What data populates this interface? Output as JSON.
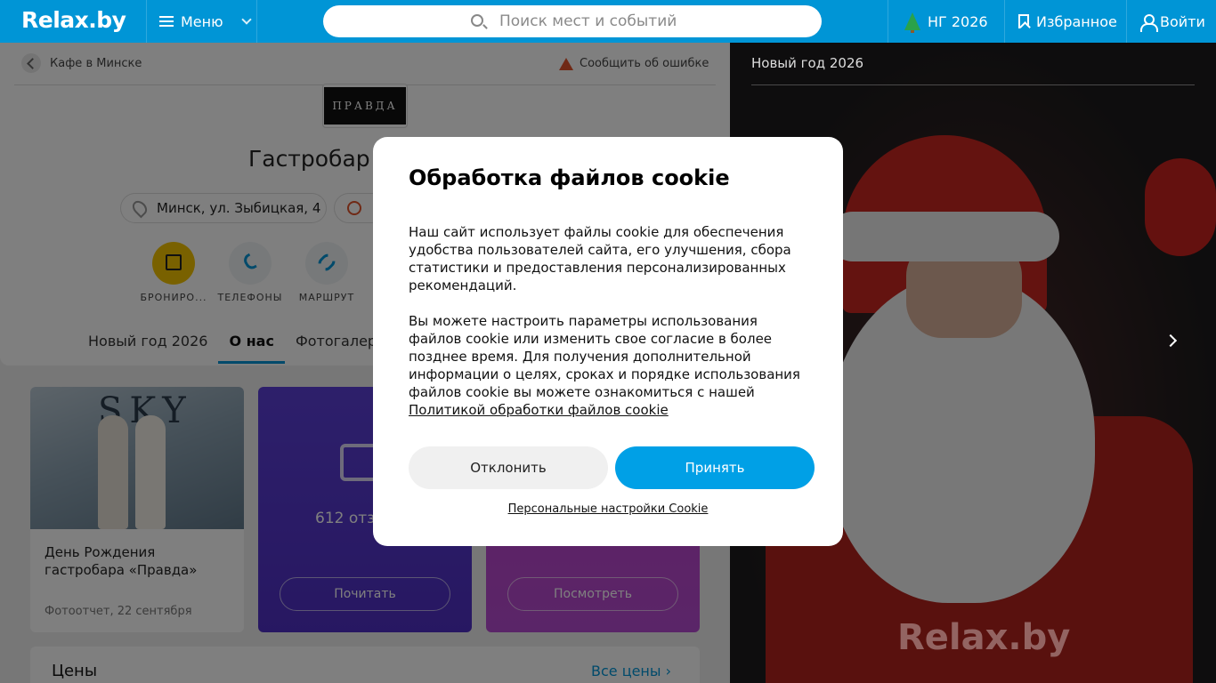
{
  "header": {
    "logo": "Relax.by",
    "menu_label": "Меню",
    "search_placeholder": "Поиск мест и событий",
    "ng_label": "НГ 2026",
    "favorites_label": "Избранное",
    "login_label": "Войти"
  },
  "venue": {
    "back_label": "Кафе в Минске",
    "report_label": "Сообщить об ошибке",
    "logo_text": "ПРАВДА",
    "title": "Гастробар",
    "address": "Минск, ул. Зыбицкая, 4",
    "actions": [
      {
        "label": "БРОНИРО..."
      },
      {
        "label": "ТЕЛЕФОНЫ"
      },
      {
        "label": "МАРШРУТ"
      }
    ],
    "tabs": [
      {
        "label": "Новый год 2026"
      },
      {
        "label": "О нас"
      },
      {
        "label": "Фотогалерея"
      }
    ]
  },
  "tiles": {
    "photo": {
      "sign_text": "SKY",
      "caption": "День Рождения гастробара «Правда»",
      "meta": "Фотоотчет, 22 сентября"
    },
    "reviews": {
      "count_text": "612 отз",
      "button": "Почитать"
    },
    "gallery": {
      "button": "Посмотреть"
    }
  },
  "prices": {
    "title": "Цены",
    "all_link": "Все цены"
  },
  "right_panel": {
    "title": "Новый год 2026",
    "watermark": "Relax.by"
  },
  "cookie_modal": {
    "title": "Обработка файлов cookie",
    "paragraph1": "Наш сайт использует файлы cookie для обеспечения удобства пользователей сайта, его улучшения, сбора статистики и предоставления персонализированных рекомендаций.",
    "paragraph2": "Вы можете настроить параметры использования файлов cookie или изменить свое согласие в более позднее время. Для получения дополнительной информации о целях, сроках и порядке использования файлов cookie вы можете ознакомиться с нашей",
    "policy_link": "Политикой обработки файлов cookie",
    "decline": "Отклонить",
    "accept": "Принять",
    "settings_link": "Персональные настройки Cookie",
    "accent_color": "#00a0e6"
  }
}
